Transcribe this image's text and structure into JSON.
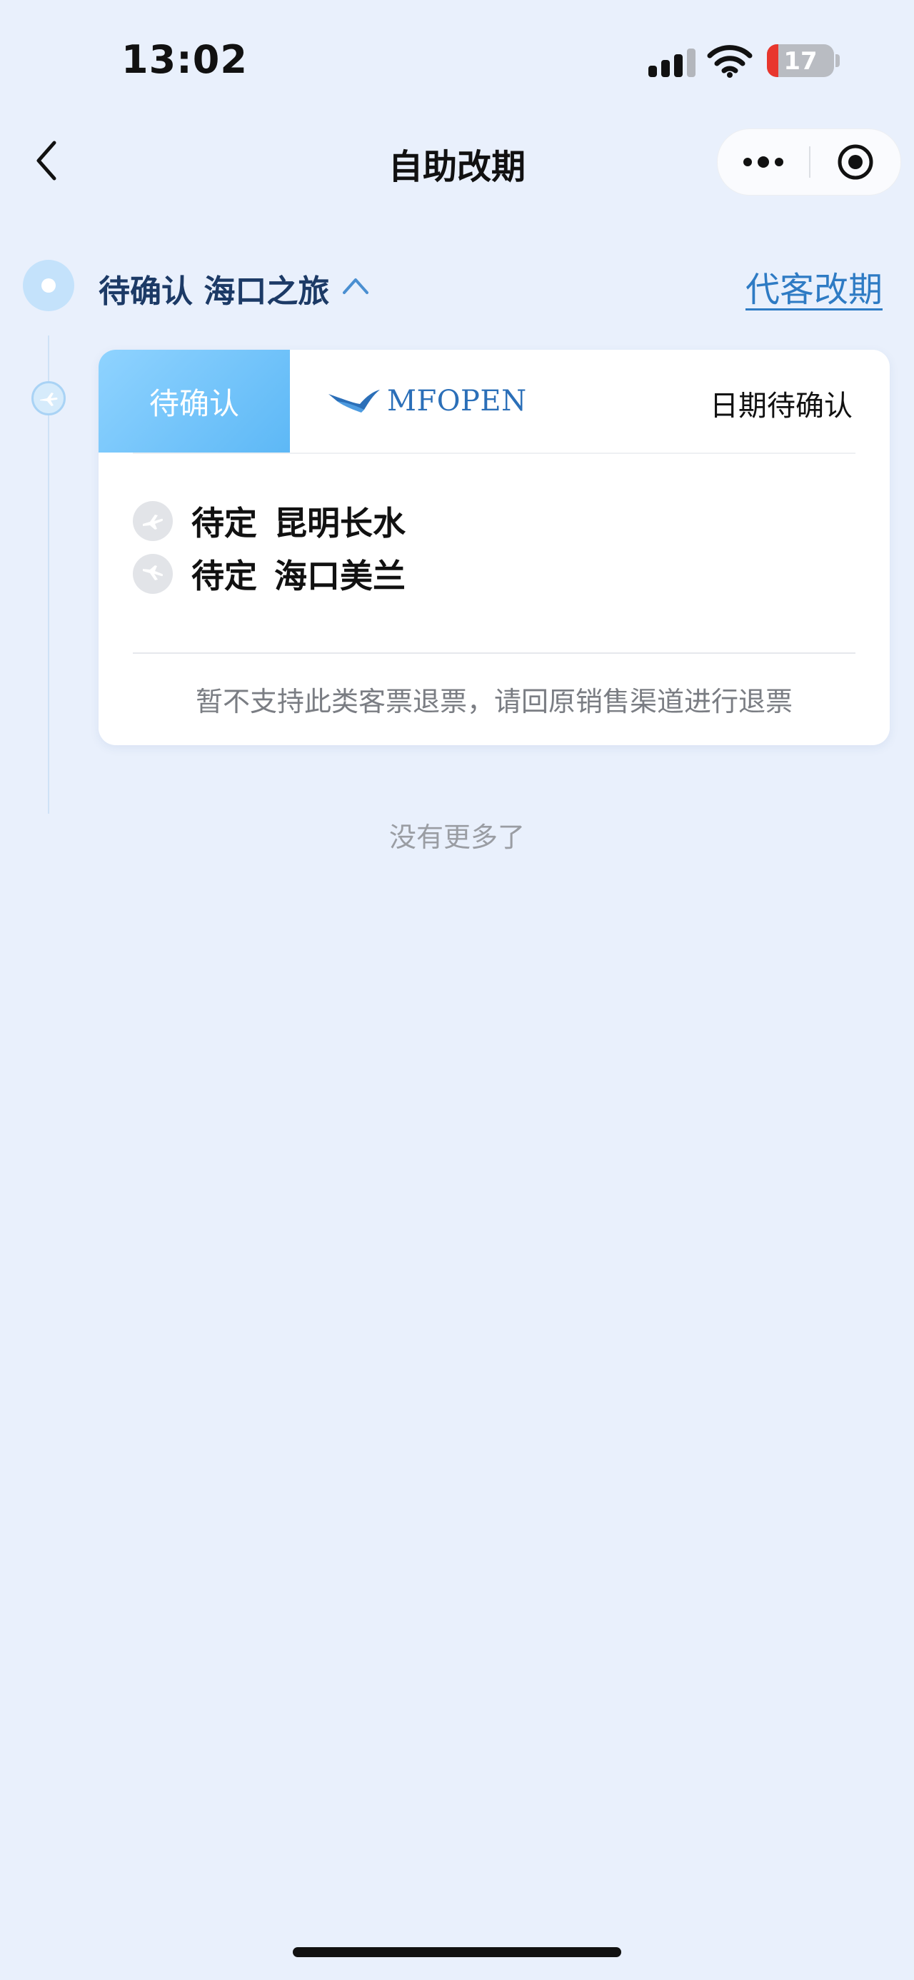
{
  "status_bar": {
    "time": "13:02",
    "battery_level": "17",
    "battery_fraction": 0.17,
    "icons": [
      "signal-icon",
      "wifi-icon",
      "battery-icon"
    ]
  },
  "nav": {
    "title": "自助改期",
    "back_icon": "chevron-left-icon",
    "more_icon": "more-dots-icon",
    "close_icon": "target-circle-icon"
  },
  "trip": {
    "title": "待确认 海口之旅",
    "collapse_icon": "chevron-up-icon",
    "rebook_link": "代客改期"
  },
  "order": {
    "status_tag": "待确认",
    "airline": "MFOPEN",
    "airline_icon": "airline-bird-logo",
    "date_status": "日期待确认",
    "segments": [
      {
        "icon": "takeoff-icon",
        "time": "待定",
        "airport": "昆明长水"
      },
      {
        "icon": "landing-icon",
        "time": "待定",
        "airport": "海口美兰"
      }
    ],
    "refund_note": "暂不支持此类客票退票，请回原销售渠道进行退票"
  },
  "footer": {
    "no_more": "没有更多了"
  },
  "colors": {
    "background": "#e9f0fc",
    "accent": "#5db8f6",
    "link": "#2e7bc4",
    "trip_title": "#1c3a66"
  }
}
